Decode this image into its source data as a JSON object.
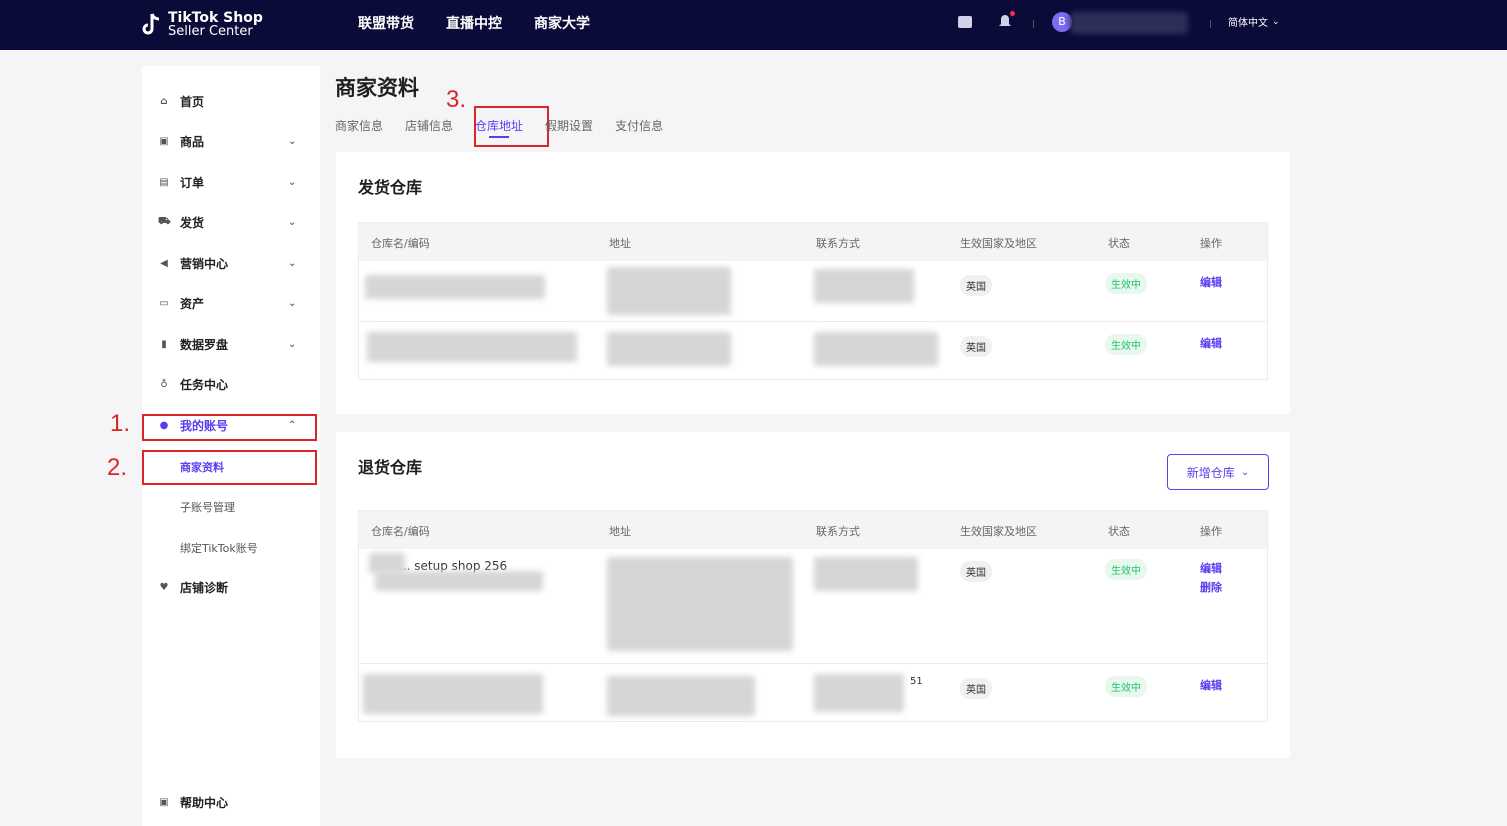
{
  "brand": {
    "line1": "TikTok Shop",
    "line2": "Seller Center"
  },
  "nav": [
    "联盟带货",
    "直播中控",
    "商家大学"
  ],
  "topright": {
    "avatar_letter": "B",
    "language": "简体中文"
  },
  "sidebar": {
    "items": [
      "首页",
      "商品",
      "订单",
      "发货",
      "营销中心",
      "资产",
      "数据罗盘",
      "任务中心",
      "我的账号"
    ],
    "sub": [
      "商家资料",
      "子账号管理",
      "绑定TikTok账号"
    ],
    "items2": [
      "店铺诊断",
      "帮助中心"
    ]
  },
  "annotations": [
    "1.",
    "2.",
    "3."
  ],
  "page": {
    "title": "商家资料",
    "tabs": [
      "商家信息",
      "店铺信息",
      "仓库地址",
      "假期设置",
      "支付信息"
    ]
  },
  "ship": {
    "title": "发货仓库",
    "columns": [
      "仓库名/编码",
      "地址",
      "联系方式",
      "生效国家及地区",
      "状态",
      "操作"
    ],
    "rows": [
      {
        "country": "英国",
        "status": "生效中",
        "action": "编辑"
      },
      {
        "country": "英国",
        "status": "生效中",
        "action": "编辑"
      }
    ]
  },
  "returns": {
    "title": "退货仓库",
    "add_button": "新增仓库",
    "columns": [
      "仓库名/编码",
      "地址",
      "联系方式",
      "生效国家及地区",
      "状态",
      "操作"
    ],
    "rows": [
      {
        "name_partial": "... setup shop 256",
        "country": "英国",
        "status": "生效中",
        "action": "编辑",
        "action2": "删除"
      },
      {
        "contact_suffix": "51",
        "country": "英国",
        "status": "生效中",
        "action": "编辑"
      }
    ]
  },
  "colors": {
    "topbar": "#0b0b3a",
    "accent": "#5a3ff0",
    "annotation": "#d9262b",
    "status_green": "#1ec46c"
  }
}
